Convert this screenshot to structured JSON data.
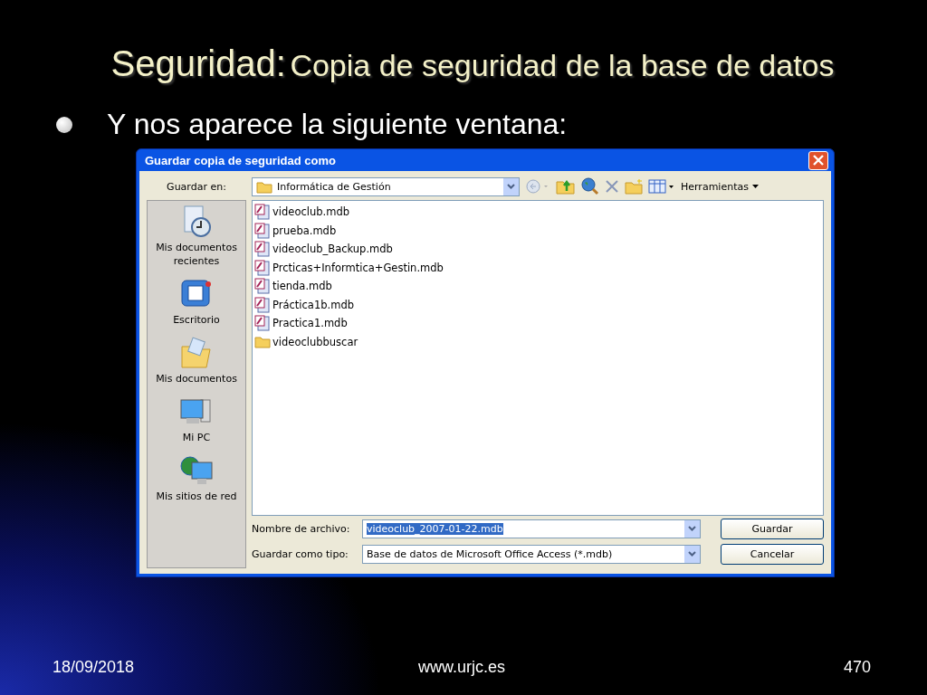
{
  "slide": {
    "title_lead": "Seguridad:",
    "title_rest": "Copia de seguridad  de la base de datos",
    "bullet": "Y nos aparece la siguiente ventana:"
  },
  "dialog": {
    "title": "Guardar copia de seguridad como",
    "location_label": "Guardar en:",
    "location": "Informática de Gestión",
    "tools_label": "Herramientas",
    "places": [
      {
        "kind": "recent",
        "label": "Mis documentos recientes"
      },
      {
        "kind": "desktop",
        "label": "Escritorio"
      },
      {
        "kind": "documents",
        "label": "Mis documentos"
      },
      {
        "kind": "computer",
        "label": "Mi PC"
      },
      {
        "kind": "network",
        "label": "Mis sitios de red"
      }
    ],
    "files": [
      {
        "kind": "mdb",
        "name": "videoclub.mdb"
      },
      {
        "kind": "mdb",
        "name": "prueba.mdb"
      },
      {
        "kind": "mdb",
        "name": "videoclub_Backup.mdb"
      },
      {
        "kind": "mdb",
        "name": "Prcticas+Informtica+Gestin.mdb"
      },
      {
        "kind": "mdb",
        "name": "tienda.mdb"
      },
      {
        "kind": "mdb",
        "name": "Práctica1b.mdb"
      },
      {
        "kind": "mdb",
        "name": "Practica1.mdb"
      },
      {
        "kind": "folder",
        "name": "videoclubbuscar"
      }
    ],
    "filename_label": "Nombre de archivo:",
    "filename": "videoclub_2007-01-22.mdb",
    "filename_selected": true,
    "type_label": "Guardar como tipo:",
    "type": "Base de datos de Microsoft Office Access (*.mdb)",
    "buttons": [
      "Guardar",
      "Cancelar"
    ]
  },
  "footer": {
    "date": "18/09/2018",
    "url": "www.urjc.es",
    "page": "470"
  }
}
